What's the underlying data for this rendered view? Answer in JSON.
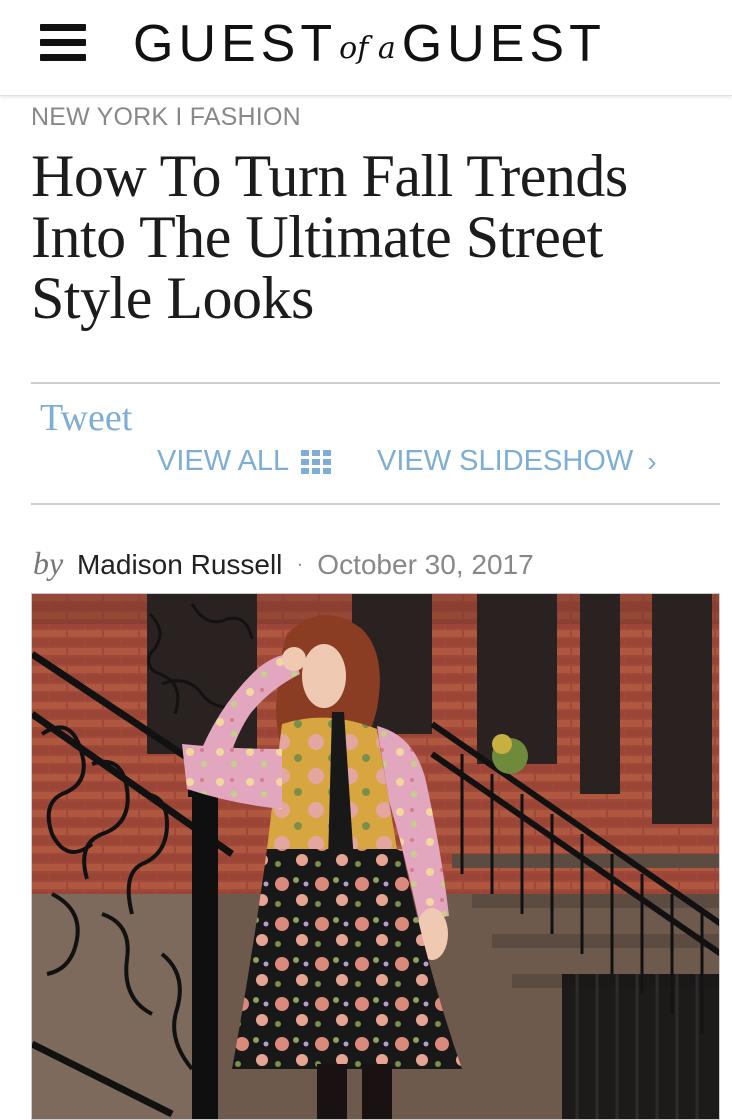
{
  "header": {
    "menu_icon": "hamburger-menu-icon",
    "logo": {
      "left": "GUEST",
      "middle": "of a",
      "right": "GUEST"
    }
  },
  "article": {
    "category": "NEW YORK I FASHION",
    "title": "How To Turn Fall Trends Into The Ultimate Street Style Looks",
    "share": {
      "tweet_label": "Tweet",
      "view_all_label": "VIEW ALL",
      "view_slideshow_label": "VIEW SLIDESHOW"
    },
    "byline": {
      "prefix": "by",
      "author": "Madison Russell",
      "separator": "·",
      "date": "October 30, 2017"
    },
    "hero_image": {
      "description_icon": "photo-woman-floral-dress-stoop"
    }
  },
  "colors": {
    "link": "#7eaed6",
    "text": "#1e1e1e",
    "muted": "#888888",
    "brick": "#a0493a",
    "iron": "#121212",
    "dress_pink": "#e2a7bf",
    "dress_yellow": "#d8a640",
    "dress_black": "#181818",
    "hair": "#8a3d22"
  }
}
